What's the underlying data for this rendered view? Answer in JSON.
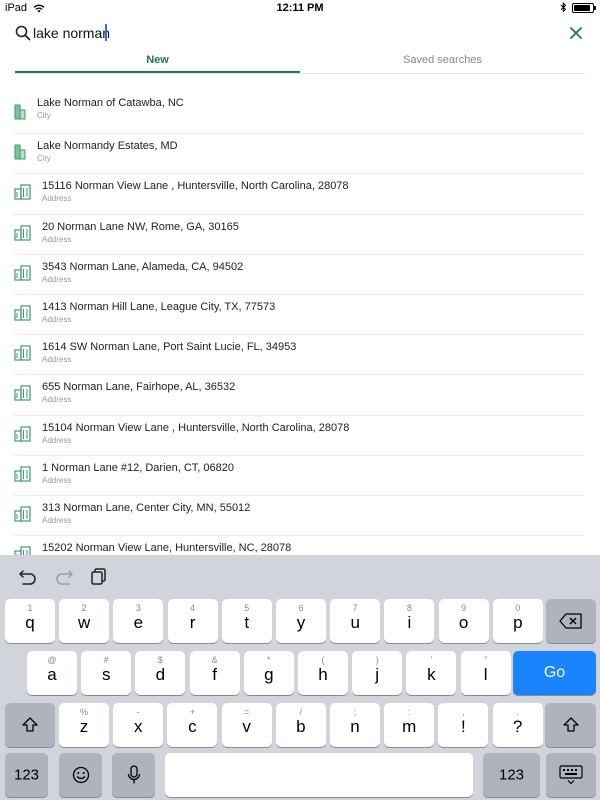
{
  "status_bar": {
    "device": "iPad",
    "time": "12:11 PM",
    "battery_level": 0.9,
    "icons": {
      "wifi": "wifi-icon",
      "bluetooth": "bluetooth-icon",
      "battery": "battery-icon"
    }
  },
  "search": {
    "query": "lake norman",
    "search_icon": "search-icon",
    "close_icon": "close-icon"
  },
  "colors": {
    "accent": "#1f7a45",
    "go_key": "#1a84ff",
    "keyboard_bg": "#d1d4da"
  },
  "tabs": [
    {
      "label": "New",
      "active": true
    },
    {
      "label": "Saved searches",
      "active": false
    }
  ],
  "results": [
    {
      "title": "Lake Norman of Catawba, NC",
      "type": "City",
      "icon": "city-icon"
    },
    {
      "title": "Lake Normandy Estates, MD",
      "type": "City",
      "icon": "city-icon"
    },
    {
      "title": "15116 Norman View Lane , Huntersville, North Carolina, 28078",
      "type": "Address",
      "icon": "building-icon"
    },
    {
      "title": "20 Norman Lane NW, Rome, GA, 30165",
      "type": "Address",
      "icon": "building-icon"
    },
    {
      "title": "3543 Norman Lane, Alameda, CA, 94502",
      "type": "Address",
      "icon": "building-icon"
    },
    {
      "title": "1413 Norman Hill Lane, League City, TX, 77573",
      "type": "Address",
      "icon": "building-icon"
    },
    {
      "title": "1614 SW Norman Lane, Port Saint Lucie, FL, 34953",
      "type": "Address",
      "icon": "building-icon"
    },
    {
      "title": "655 Norman Lane, Fairhope, AL, 36532",
      "type": "Address",
      "icon": "building-icon"
    },
    {
      "title": "15104 Norman View Lane , Huntersville, North Carolina, 28078",
      "type": "Address",
      "icon": "building-icon"
    },
    {
      "title": "1 Norman Lane #12, Darien, CT, 06820",
      "type": "Address",
      "icon": "building-icon"
    },
    {
      "title": "313 Norman Lane, Center City, MN, 55012",
      "type": "Address",
      "icon": "building-icon"
    },
    {
      "title": "15202 Norman View Lane, Huntersville, NC, 28078",
      "type": "Address",
      "icon": "building-icon"
    }
  ],
  "keyboard": {
    "toolbar": {
      "undo": "undo-icon",
      "redo": "redo-icon",
      "paste": "paste-icon"
    },
    "row1": [
      {
        "main": "q",
        "alt": "1"
      },
      {
        "main": "w",
        "alt": "2"
      },
      {
        "main": "e",
        "alt": "3"
      },
      {
        "main": "r",
        "alt": "4"
      },
      {
        "main": "t",
        "alt": "5"
      },
      {
        "main": "y",
        "alt": "6"
      },
      {
        "main": "u",
        "alt": "7"
      },
      {
        "main": "i",
        "alt": "8"
      },
      {
        "main": "o",
        "alt": "9"
      },
      {
        "main": "p",
        "alt": "0"
      }
    ],
    "row2": [
      {
        "main": "a",
        "alt": "@"
      },
      {
        "main": "s",
        "alt": "#"
      },
      {
        "main": "d",
        "alt": "$"
      },
      {
        "main": "f",
        "alt": "&"
      },
      {
        "main": "g",
        "alt": "*"
      },
      {
        "main": "h",
        "alt": "("
      },
      {
        "main": "j",
        "alt": ")"
      },
      {
        "main": "k",
        "alt": "’"
      },
      {
        "main": "l",
        "alt": "”"
      }
    ],
    "row3": [
      {
        "main": "z",
        "alt": "%"
      },
      {
        "main": "x",
        "alt": "-"
      },
      {
        "main": "c",
        "alt": "+"
      },
      {
        "main": "v",
        "alt": "="
      },
      {
        "main": "b",
        "alt": "/"
      },
      {
        "main": "n",
        "alt": ";"
      },
      {
        "main": "m",
        "alt": ":"
      },
      {
        "main": "!",
        "alt": ","
      },
      {
        "main": "?",
        "alt": "."
      }
    ],
    "go_label": "Go",
    "numbers_label": "123",
    "icons": {
      "backspace": "backspace-icon",
      "shift": "shift-icon",
      "emoji": "emoji-icon",
      "mic": "microphone-icon",
      "hide": "keyboard-hide-icon"
    }
  }
}
